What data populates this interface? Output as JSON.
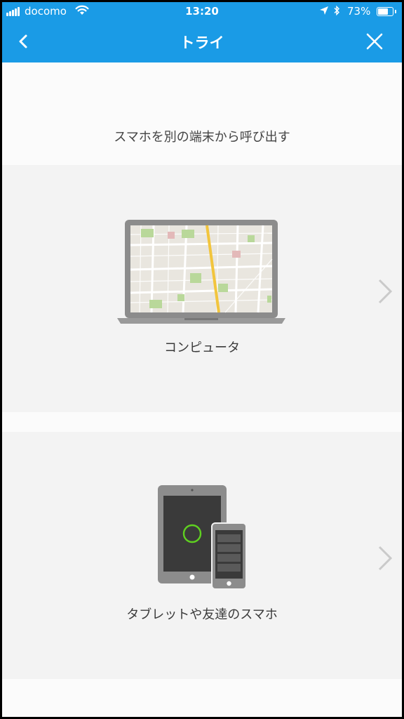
{
  "status_bar": {
    "carrier": "docomo",
    "time": "13:20",
    "battery_percent_text": "73%",
    "battery_level": 0.73
  },
  "nav": {
    "title": "トライ"
  },
  "subtitle": "スマホを別の端末から呼び出す",
  "options": [
    {
      "label": "コンピュータ",
      "icon": "laptop-map-icon"
    },
    {
      "label": "タブレットや友達のスマホ",
      "icon": "tablet-phone-icon"
    }
  ],
  "colors": {
    "header": "#1a9be6",
    "card_background": "#f3f3f3",
    "ring_accent": "#5fd120"
  }
}
